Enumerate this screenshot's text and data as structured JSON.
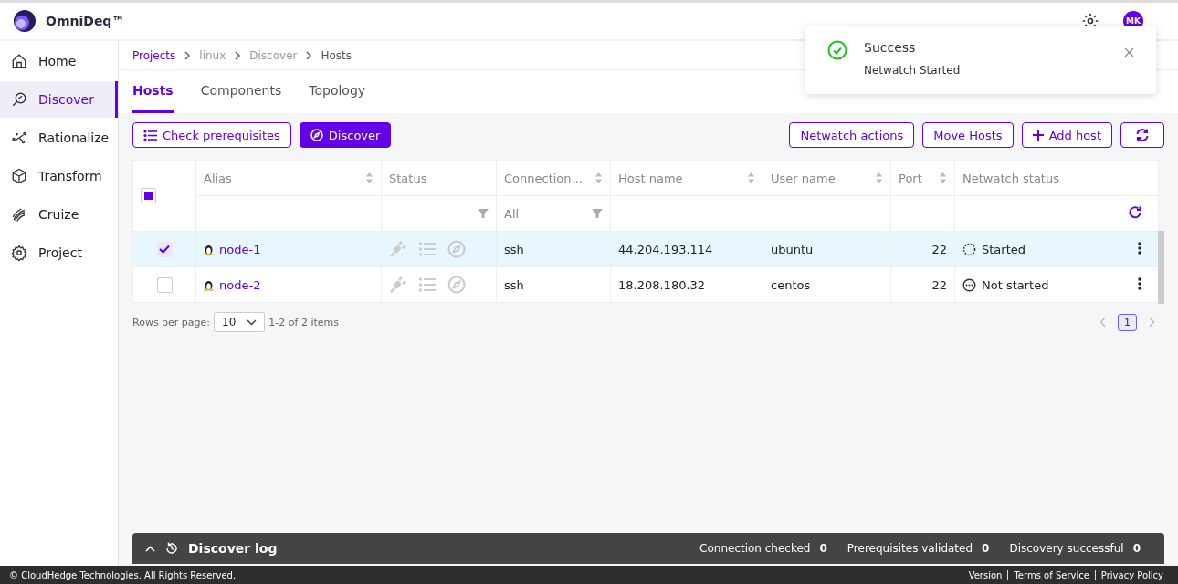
{
  "header": {
    "brand": "OmniDeq™",
    "avatar": "MK"
  },
  "sidebar": {
    "items": [
      {
        "label": "Home",
        "selected": false
      },
      {
        "label": "Discover",
        "selected": true
      },
      {
        "label": "Rationalize",
        "selected": false
      },
      {
        "label": "Transform",
        "selected": false
      },
      {
        "label": "Cruize",
        "selected": false
      },
      {
        "label": "Project",
        "selected": false
      }
    ]
  },
  "breadcrumb": [
    {
      "label": "Projects",
      "kind": "link"
    },
    {
      "label": "linux",
      "kind": "muted"
    },
    {
      "label": "Discover",
      "kind": "muted"
    },
    {
      "label": "Hosts",
      "kind": "current"
    }
  ],
  "tabs": [
    {
      "label": "Hosts",
      "selected": true
    },
    {
      "label": "Components",
      "selected": false
    },
    {
      "label": "Topology",
      "selected": false
    }
  ],
  "toolbar": {
    "left": [
      {
        "label": "Check prerequisites",
        "primary": false
      },
      {
        "label": "Discover",
        "primary": true
      }
    ],
    "right": [
      {
        "label": "Netwatch actions"
      },
      {
        "label": "Move Hosts"
      },
      {
        "label": "Add host"
      }
    ]
  },
  "table": {
    "select_all": {
      "indeterminate": true
    },
    "columns": [
      {
        "label": "Alias",
        "sortable": true,
        "filterable": false
      },
      {
        "label": "Status",
        "sortable": false,
        "filterable": true
      },
      {
        "label": "Connection...",
        "sortable": true,
        "filterable": true,
        "filter_value": "All"
      },
      {
        "label": "Host name",
        "sortable": true,
        "filterable": false
      },
      {
        "label": "User name",
        "sortable": true,
        "filterable": false
      },
      {
        "label": "Port",
        "sortable": true,
        "filterable": false
      },
      {
        "label": "Netwatch status",
        "sortable": false,
        "filterable": false
      }
    ],
    "rows": [
      {
        "selected": true,
        "alias": "node-1",
        "connection": "ssh",
        "host": "44.204.193.114",
        "user": "ubuntu",
        "port": "22",
        "netwatch": {
          "kind": "started",
          "label": "Started"
        }
      },
      {
        "selected": false,
        "alias": "node-2",
        "connection": "ssh",
        "host": "18.208.180.32",
        "user": "centos",
        "port": "22",
        "netwatch": {
          "kind": "not_started",
          "label": "Not started"
        }
      }
    ]
  },
  "pagination": {
    "rows_per_page_label": "Rows per page:",
    "rows_per_page": "10",
    "range": "1-2 of 2 items",
    "pages": [
      {
        "label": "1",
        "selected": true
      }
    ]
  },
  "discover_log": {
    "title": "Discover log",
    "counters": [
      {
        "label": "Connection checked",
        "value": "0"
      },
      {
        "label": "Prerequisites validated",
        "value": "0"
      },
      {
        "label": "Discovery successful",
        "value": "0"
      }
    ]
  },
  "footer": {
    "copyright": "© CloudHedge Technologies. All Rights Reserved.",
    "links": [
      "Version",
      "Terms of Service",
      "Privacy Policy"
    ]
  },
  "toast": {
    "kind": "success",
    "title": "Success",
    "message": "Netwatch Started"
  }
}
